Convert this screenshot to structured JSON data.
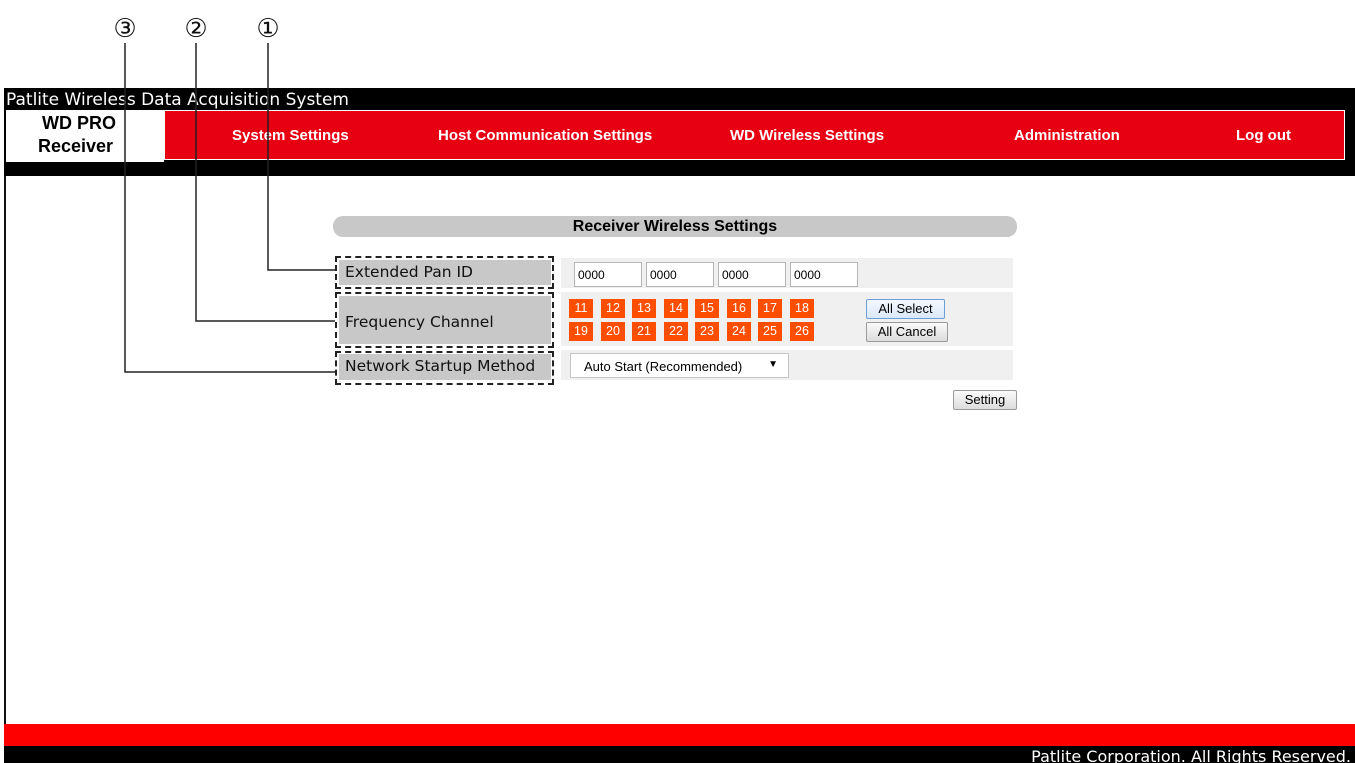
{
  "callouts": [
    "③",
    "②",
    "①"
  ],
  "app": {
    "title": "Patlite Wireless Data Acquisition System",
    "logo_line1": "WD PRO",
    "logo_line2": "Receiver"
  },
  "nav": {
    "items": [
      {
        "label": "System Settings"
      },
      {
        "label": "Host Communication Settings"
      },
      {
        "label": "WD Wireless Settings"
      },
      {
        "label": "Administration"
      },
      {
        "label": "Log out"
      }
    ]
  },
  "panel": {
    "title": "Receiver Wireless Settings",
    "extended_pan_id": {
      "label": "Extended Pan ID",
      "values": [
        "0000",
        "0000",
        "0000",
        "0000"
      ]
    },
    "frequency_channel": {
      "label": "Frequency Channel",
      "channels_row1": [
        "11",
        "12",
        "13",
        "14",
        "15",
        "16",
        "17",
        "18"
      ],
      "channels_row2": [
        "19",
        "20",
        "21",
        "22",
        "23",
        "24",
        "25",
        "26"
      ],
      "all_select_label": "All Select",
      "all_cancel_label": "All Cancel",
      "channel_color": "#ff4e00"
    },
    "network_startup_method": {
      "label": "Network Startup Method",
      "selected": "Auto Start (Recommended)"
    },
    "setting_button": "Setting"
  },
  "footer": {
    "copyright": "Patlite Corporation. All Rights Reserved."
  },
  "colors": {
    "brand_red": "#e60012",
    "footer_red": "#ff0000",
    "channel_orange": "#ff4e00"
  }
}
